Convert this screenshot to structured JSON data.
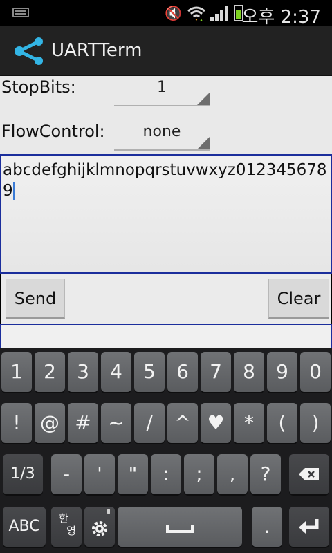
{
  "statusbar": {
    "time": "오후 2:37"
  },
  "appbar": {
    "title": "UARTTerm"
  },
  "form": {
    "stopbits_label": "StopBits:",
    "stopbits_value": "1",
    "flowcontrol_label": "FlowControl:",
    "flowcontrol_value": "none"
  },
  "editor": {
    "text": "abcdefghijklmnopqrstuvwxyz0123456789"
  },
  "buttons": {
    "send": "Send",
    "clear": "Clear"
  },
  "keyboard": {
    "row1": [
      "1",
      "2",
      "3",
      "4",
      "5",
      "6",
      "7",
      "8",
      "9",
      "0"
    ],
    "row2": [
      "!",
      "@",
      "#",
      "~",
      "/",
      "^",
      "♥",
      "*",
      "(",
      ")"
    ],
    "row3": [
      "1/3",
      "-",
      "'",
      "\"",
      ":",
      ";",
      ",",
      "?"
    ],
    "row4": {
      "abc": "ABC",
      "lang_top": "한",
      "lang_bottom": "영",
      "period": "."
    }
  },
  "colors": {
    "accent": "#33b5e5",
    "field_border": "#1b2e9c",
    "battery": "#7ed321"
  }
}
